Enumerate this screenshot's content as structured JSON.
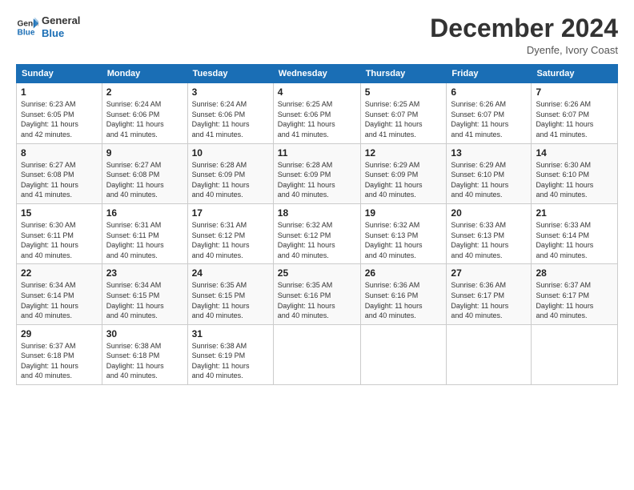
{
  "logo": {
    "line1": "General",
    "line2": "Blue"
  },
  "title": "December 2024",
  "location": "Dyenfe, Ivory Coast",
  "days_header": [
    "Sunday",
    "Monday",
    "Tuesday",
    "Wednesday",
    "Thursday",
    "Friday",
    "Saturday"
  ],
  "weeks": [
    [
      {
        "day": "1",
        "sunrise": "6:23 AM",
        "sunset": "6:05 PM",
        "daylight": "11 hours and 42 minutes."
      },
      {
        "day": "2",
        "sunrise": "6:24 AM",
        "sunset": "6:06 PM",
        "daylight": "11 hours and 41 minutes."
      },
      {
        "day": "3",
        "sunrise": "6:24 AM",
        "sunset": "6:06 PM",
        "daylight": "11 hours and 41 minutes."
      },
      {
        "day": "4",
        "sunrise": "6:25 AM",
        "sunset": "6:06 PM",
        "daylight": "11 hours and 41 minutes."
      },
      {
        "day": "5",
        "sunrise": "6:25 AM",
        "sunset": "6:07 PM",
        "daylight": "11 hours and 41 minutes."
      },
      {
        "day": "6",
        "sunrise": "6:26 AM",
        "sunset": "6:07 PM",
        "daylight": "11 hours and 41 minutes."
      },
      {
        "day": "7",
        "sunrise": "6:26 AM",
        "sunset": "6:07 PM",
        "daylight": "11 hours and 41 minutes."
      }
    ],
    [
      {
        "day": "8",
        "sunrise": "6:27 AM",
        "sunset": "6:08 PM",
        "daylight": "11 hours and 41 minutes."
      },
      {
        "day": "9",
        "sunrise": "6:27 AM",
        "sunset": "6:08 PM",
        "daylight": "11 hours and 40 minutes."
      },
      {
        "day": "10",
        "sunrise": "6:28 AM",
        "sunset": "6:09 PM",
        "daylight": "11 hours and 40 minutes."
      },
      {
        "day": "11",
        "sunrise": "6:28 AM",
        "sunset": "6:09 PM",
        "daylight": "11 hours and 40 minutes."
      },
      {
        "day": "12",
        "sunrise": "6:29 AM",
        "sunset": "6:09 PM",
        "daylight": "11 hours and 40 minutes."
      },
      {
        "day": "13",
        "sunrise": "6:29 AM",
        "sunset": "6:10 PM",
        "daylight": "11 hours and 40 minutes."
      },
      {
        "day": "14",
        "sunrise": "6:30 AM",
        "sunset": "6:10 PM",
        "daylight": "11 hours and 40 minutes."
      }
    ],
    [
      {
        "day": "15",
        "sunrise": "6:30 AM",
        "sunset": "6:11 PM",
        "daylight": "11 hours and 40 minutes."
      },
      {
        "day": "16",
        "sunrise": "6:31 AM",
        "sunset": "6:11 PM",
        "daylight": "11 hours and 40 minutes."
      },
      {
        "day": "17",
        "sunrise": "6:31 AM",
        "sunset": "6:12 PM",
        "daylight": "11 hours and 40 minutes."
      },
      {
        "day": "18",
        "sunrise": "6:32 AM",
        "sunset": "6:12 PM",
        "daylight": "11 hours and 40 minutes."
      },
      {
        "day": "19",
        "sunrise": "6:32 AM",
        "sunset": "6:13 PM",
        "daylight": "11 hours and 40 minutes."
      },
      {
        "day": "20",
        "sunrise": "6:33 AM",
        "sunset": "6:13 PM",
        "daylight": "11 hours and 40 minutes."
      },
      {
        "day": "21",
        "sunrise": "6:33 AM",
        "sunset": "6:14 PM",
        "daylight": "11 hours and 40 minutes."
      }
    ],
    [
      {
        "day": "22",
        "sunrise": "6:34 AM",
        "sunset": "6:14 PM",
        "daylight": "11 hours and 40 minutes."
      },
      {
        "day": "23",
        "sunrise": "6:34 AM",
        "sunset": "6:15 PM",
        "daylight": "11 hours and 40 minutes."
      },
      {
        "day": "24",
        "sunrise": "6:35 AM",
        "sunset": "6:15 PM",
        "daylight": "11 hours and 40 minutes."
      },
      {
        "day": "25",
        "sunrise": "6:35 AM",
        "sunset": "6:16 PM",
        "daylight": "11 hours and 40 minutes."
      },
      {
        "day": "26",
        "sunrise": "6:36 AM",
        "sunset": "6:16 PM",
        "daylight": "11 hours and 40 minutes."
      },
      {
        "day": "27",
        "sunrise": "6:36 AM",
        "sunset": "6:17 PM",
        "daylight": "11 hours and 40 minutes."
      },
      {
        "day": "28",
        "sunrise": "6:37 AM",
        "sunset": "6:17 PM",
        "daylight": "11 hours and 40 minutes."
      }
    ],
    [
      {
        "day": "29",
        "sunrise": "6:37 AM",
        "sunset": "6:18 PM",
        "daylight": "11 hours and 40 minutes."
      },
      {
        "day": "30",
        "sunrise": "6:38 AM",
        "sunset": "6:18 PM",
        "daylight": "11 hours and 40 minutes."
      },
      {
        "day": "31",
        "sunrise": "6:38 AM",
        "sunset": "6:19 PM",
        "daylight": "11 hours and 40 minutes."
      },
      null,
      null,
      null,
      null
    ]
  ],
  "labels": {
    "sunrise": "Sunrise: ",
    "sunset": "Sunset: ",
    "daylight": "Daylight: "
  }
}
